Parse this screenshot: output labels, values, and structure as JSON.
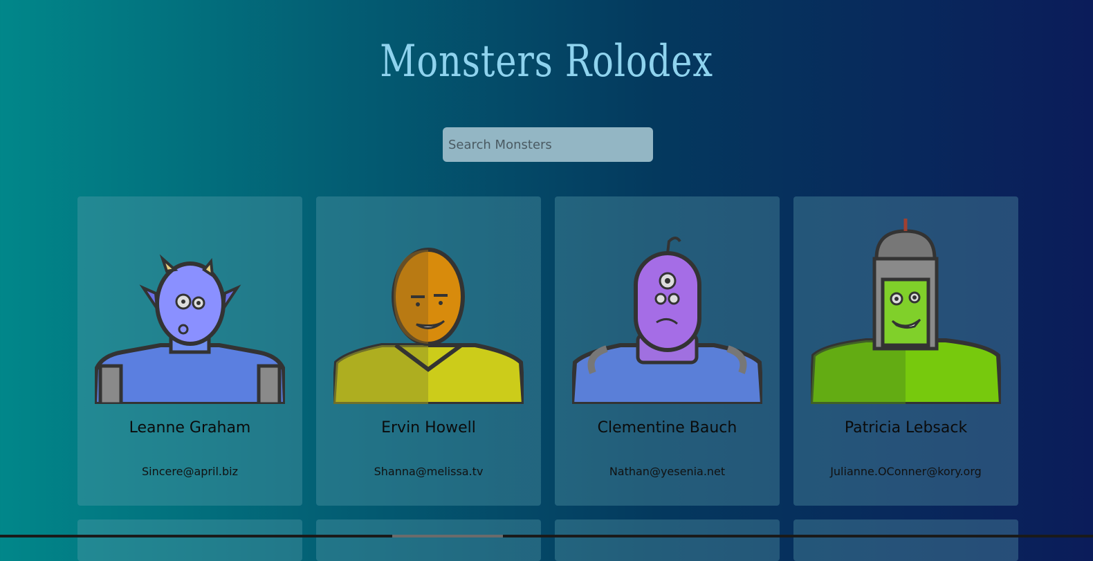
{
  "header": {
    "title": "Monsters Rolodex"
  },
  "search": {
    "placeholder": "Search Monsters",
    "value": ""
  },
  "monsters": [
    {
      "name": "Leanne Graham",
      "email": "Sincere@april.biz"
    },
    {
      "name": "Ervin Howell",
      "email": "Shanna@melissa.tv"
    },
    {
      "name": "Clementine Bauch",
      "email": "Nathan@yesenia.net"
    },
    {
      "name": "Patricia Lebsack",
      "email": "Julianne.OConner@kory.org"
    }
  ]
}
